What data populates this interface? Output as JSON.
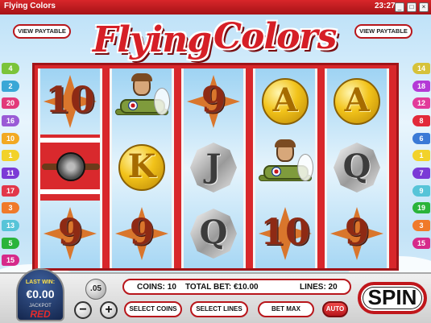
{
  "window": {
    "title": "Flying Colors",
    "clock": "23:27",
    "buttons": [
      "_",
      "□",
      "×"
    ]
  },
  "header": {
    "logo_line1": "Flying",
    "logo_line2": "Colors",
    "paytable_left": "VIEW PAYTABLE",
    "paytable_right": "VIEW PAYTABLE"
  },
  "left_flags": [
    {
      "num": "4",
      "color": "#7bc43a"
    },
    {
      "num": "2",
      "color": "#3aa7d6"
    },
    {
      "num": "20",
      "color": "#e23a7a"
    },
    {
      "num": "16",
      "color": "#9a5bd6"
    },
    {
      "num": "10",
      "color": "#f2a922"
    },
    {
      "num": "1",
      "color": "#f2d22a"
    },
    {
      "num": "11",
      "color": "#7b3ad6"
    },
    {
      "num": "17",
      "color": "#e2374a"
    },
    {
      "num": "3",
      "color": "#f07a2a"
    },
    {
      "num": "13",
      "color": "#57c4d8"
    },
    {
      "num": "5",
      "color": "#2ab43a"
    },
    {
      "num": "15",
      "color": "#d62a8a"
    }
  ],
  "right_flags": [
    {
      "num": "14",
      "color": "#d6c23a"
    },
    {
      "num": "18",
      "color": "#b43ad6"
    },
    {
      "num": "12",
      "color": "#e23a9a"
    },
    {
      "num": "8",
      "color": "#e22a3a"
    },
    {
      "num": "6",
      "color": "#3a7ad6"
    },
    {
      "num": "1",
      "color": "#f2d22a"
    },
    {
      "num": "7",
      "color": "#7a3ad6"
    },
    {
      "num": "9",
      "color": "#57c4d8"
    },
    {
      "num": "19",
      "color": "#2ab43a"
    },
    {
      "num": "3",
      "color": "#f07a2a"
    },
    {
      "num": "15",
      "color": "#d62a8a"
    }
  ],
  "reels": [
    [
      {
        "type": "num",
        "label": "10"
      },
      {
        "type": "red",
        "label": ""
      },
      {
        "type": "num",
        "label": "9"
      }
    ],
    [
      {
        "type": "plane",
        "label": ""
      },
      {
        "type": "gold",
        "label": "K"
      },
      {
        "type": "num",
        "label": "9"
      }
    ],
    [
      {
        "type": "num",
        "label": "9"
      },
      {
        "type": "silver",
        "label": "J"
      },
      {
        "type": "silver",
        "label": "Q"
      }
    ],
    [
      {
        "type": "gold",
        "label": "A"
      },
      {
        "type": "plane",
        "label": ""
      },
      {
        "type": "num",
        "label": "10"
      }
    ],
    [
      {
        "type": "gold",
        "label": "A"
      },
      {
        "type": "silver",
        "label": "Q"
      },
      {
        "type": "num",
        "label": "9"
      }
    ]
  ],
  "panel": {
    "last_win_label": "LAST WIN:",
    "last_win_value": "€0.00",
    "brand_small": "JACKPOT",
    "brand_big": "RED",
    "coin_size": ".05",
    "minus": "−",
    "plus": "+",
    "coins_text": "COINS: 10",
    "total_bet_text": "TOTAL BET: €10.00",
    "lines_text": "LINES: 20",
    "select_coins": "SELECT COINS",
    "select_lines": "SELECT LINES",
    "bet_max": "BET MAX",
    "auto": "AUTO",
    "spin": "SPIN"
  }
}
